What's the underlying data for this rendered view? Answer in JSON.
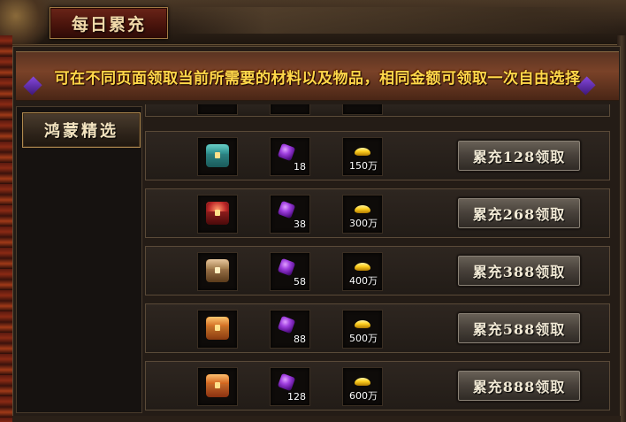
{
  "window": {
    "title": "每日累充"
  },
  "banner": {
    "text": "可在不同页面领取当前所需要的材料以及物品，相同金额可领取一次自由选择"
  },
  "sidebar": {
    "tabs": [
      {
        "label": "鸿蒙精选",
        "selected": true
      }
    ]
  },
  "rows": [
    {
      "chest_icon": "chest-teal-icon",
      "gem_count": "18",
      "gold": "150万",
      "button": "累充128领取"
    },
    {
      "chest_icon": "chest-red-icon",
      "gem_count": "38",
      "gold": "300万",
      "button": "累充268领取"
    },
    {
      "chest_icon": "chest-bronze-icon",
      "gem_count": "58",
      "gold": "400万",
      "button": "累充388领取"
    },
    {
      "chest_icon": "chest-gold-icon",
      "gem_count": "88",
      "gold": "500万",
      "button": "累充588领取"
    },
    {
      "chest_icon": "chest-gold-icon",
      "gem_count": "128",
      "gold": "600万",
      "button": "累充888领取"
    }
  ],
  "colors": {
    "banner_text": "#ffd84a",
    "title_text": "#f0d8a8",
    "button_text": "#f2ead6",
    "chest_teal": "#2a8a8a",
    "chest_red": "#c02a2a",
    "chest_bronze": "#b07a4a",
    "chest_gold": "#e07a2a",
    "gem": "#a040e0",
    "gold_ingot": "#ffd020"
  }
}
